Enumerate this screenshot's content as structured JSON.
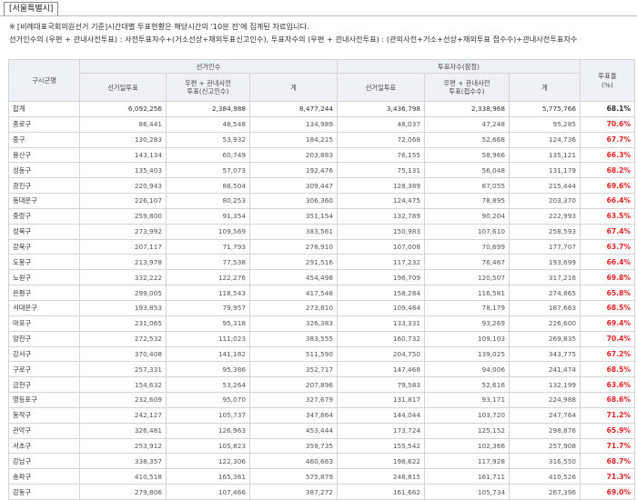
{
  "header": {
    "region_tab": "[서울특별시]"
  },
  "notes": {
    "marker": "※",
    "line1": "[비례대표국회의원선거 기준]시간대별 투표현황은 해당시간의 '10분 전'에 집계된 자료입니다.",
    "line2": "선거인수의 (우편 + 관내사전투표) : 사전투표자수+(거소선상+재외투표신고인수), 투표자수의 (우편 + 관내사전투표) : (관외사전+거소+선상+재외투표 접수수)+관내사전투표자수"
  },
  "table": {
    "headers": {
      "district": "구시군명",
      "electors_group": "선거인수",
      "voters_group": "투표자수(잠정)",
      "rate_line1": "투표율",
      "rate_line2": "(%)",
      "election_day": "선거일투표",
      "electors_mail_line1": "우편 + 관내사전",
      "electors_mail_line2": "투표(신고인수)",
      "total": "계",
      "voters_election_day": "선거일투표",
      "voters_mail_line1": "우편 + 관내사전",
      "voters_mail_line2": "투표(접수수)",
      "voters_total": "계"
    },
    "rows": [
      {
        "name": "합계",
        "e_day": "6,092,256",
        "e_mail": "2,384,988",
        "e_total": "8,477,244",
        "v_day": "3,436,798",
        "v_mail": "2,338,968",
        "v_total": "5,775,766",
        "rate": "68.1%"
      },
      {
        "name": "종로구",
        "e_day": "86,441",
        "e_mail": "48,548",
        "e_total": "134,989",
        "v_day": "48,037",
        "v_mail": "47,248",
        "v_total": "95,285",
        "rate": "70.6%"
      },
      {
        "name": "중구",
        "e_day": "130,283",
        "e_mail": "53,932",
        "e_total": "184,215",
        "v_day": "72,068",
        "v_mail": "52,668",
        "v_total": "124,736",
        "rate": "67.7%"
      },
      {
        "name": "용산구",
        "e_day": "143,134",
        "e_mail": "60,749",
        "e_total": "203,883",
        "v_day": "76,155",
        "v_mail": "58,966",
        "v_total": "135,121",
        "rate": "66.3%"
      },
      {
        "name": "성동구",
        "e_day": "135,403",
        "e_mail": "57,073",
        "e_total": "192,476",
        "v_day": "75,131",
        "v_mail": "56,048",
        "v_total": "131,179",
        "rate": "68.2%"
      },
      {
        "name": "광진구",
        "e_day": "220,943",
        "e_mail": "88,504",
        "e_total": "309,447",
        "v_day": "128,389",
        "v_mail": "87,055",
        "v_total": "215,444",
        "rate": "69.6%"
      },
      {
        "name": "동대문구",
        "e_day": "226,107",
        "e_mail": "80,253",
        "e_total": "306,360",
        "v_day": "124,475",
        "v_mail": "78,895",
        "v_total": "203,370",
        "rate": "66.4%"
      },
      {
        "name": "중랑구",
        "e_day": "259,800",
        "e_mail": "91,354",
        "e_total": "351,154",
        "v_day": "132,789",
        "v_mail": "90,204",
        "v_total": "222,993",
        "rate": "63.5%"
      },
      {
        "name": "성북구",
        "e_day": "273,992",
        "e_mail": "109,569",
        "e_total": "383,561",
        "v_day": "150,983",
        "v_mail": "107,610",
        "v_total": "258,593",
        "rate": "67.4%"
      },
      {
        "name": "강북구",
        "e_day": "207,117",
        "e_mail": "71,793",
        "e_total": "278,910",
        "v_day": "107,008",
        "v_mail": "70,699",
        "v_total": "177,707",
        "rate": "63.7%"
      },
      {
        "name": "도봉구",
        "e_day": "213,978",
        "e_mail": "77,538",
        "e_total": "291,516",
        "v_day": "117,232",
        "v_mail": "76,467",
        "v_total": "193,699",
        "rate": "66.4%"
      },
      {
        "name": "노원구",
        "e_day": "332,222",
        "e_mail": "122,276",
        "e_total": "454,498",
        "v_day": "196,709",
        "v_mail": "120,507",
        "v_total": "317,216",
        "rate": "69.8%"
      },
      {
        "name": "은평구",
        "e_day": "299,005",
        "e_mail": "118,543",
        "e_total": "417,548",
        "v_day": "158,284",
        "v_mail": "116,581",
        "v_total": "274,865",
        "rate": "65.8%"
      },
      {
        "name": "서대문구",
        "e_day": "193,853",
        "e_mail": "79,957",
        "e_total": "273,810",
        "v_day": "109,484",
        "v_mail": "78,179",
        "v_total": "187,663",
        "rate": "68.5%"
      },
      {
        "name": "마포구",
        "e_day": "231,065",
        "e_mail": "95,318",
        "e_total": "326,383",
        "v_day": "133,331",
        "v_mail": "93,269",
        "v_total": "226,600",
        "rate": "69.4%"
      },
      {
        "name": "양천구",
        "e_day": "272,532",
        "e_mail": "111,023",
        "e_total": "383,555",
        "v_day": "160,732",
        "v_mail": "109,103",
        "v_total": "269,835",
        "rate": "70.4%"
      },
      {
        "name": "강서구",
        "e_day": "370,408",
        "e_mail": "141,182",
        "e_total": "511,590",
        "v_day": "204,750",
        "v_mail": "139,025",
        "v_total": "343,775",
        "rate": "67.2%"
      },
      {
        "name": "구로구",
        "e_day": "257,331",
        "e_mail": "95,386",
        "e_total": "352,717",
        "v_day": "147,468",
        "v_mail": "94,006",
        "v_total": "241,474",
        "rate": "68.5%"
      },
      {
        "name": "금천구",
        "e_day": "154,632",
        "e_mail": "53,264",
        "e_total": "207,896",
        "v_day": "79,583",
        "v_mail": "52,616",
        "v_total": "132,199",
        "rate": "63.6%"
      },
      {
        "name": "영등포구",
        "e_day": "232,609",
        "e_mail": "95,070",
        "e_total": "327,679",
        "v_day": "131,817",
        "v_mail": "93,171",
        "v_total": "224,988",
        "rate": "68.6%"
      },
      {
        "name": "동작구",
        "e_day": "242,127",
        "e_mail": "105,737",
        "e_total": "347,864",
        "v_day": "144,044",
        "v_mail": "103,720",
        "v_total": "247,764",
        "rate": "71.2%"
      },
      {
        "name": "관악구",
        "e_day": "326,481",
        "e_mail": "126,963",
        "e_total": "453,444",
        "v_day": "173,724",
        "v_mail": "125,152",
        "v_total": "298,876",
        "rate": "65.9%"
      },
      {
        "name": "서초구",
        "e_day": "253,912",
        "e_mail": "105,823",
        "e_total": "359,735",
        "v_day": "155,542",
        "v_mail": "102,366",
        "v_total": "257,908",
        "rate": "71.7%"
      },
      {
        "name": "강남구",
        "e_day": "338,357",
        "e_mail": "122,306",
        "e_total": "460,663",
        "v_day": "198,622",
        "v_mail": "117,928",
        "v_total": "316,550",
        "rate": "68.7%"
      },
      {
        "name": "송파구",
        "e_day": "410,518",
        "e_mail": "165,361",
        "e_total": "575,879",
        "v_day": "248,815",
        "v_mail": "161,711",
        "v_total": "410,526",
        "rate": "71.3%"
      },
      {
        "name": "강동구",
        "e_day": "279,806",
        "e_mail": "107,466",
        "e_total": "387,272",
        "v_day": "161,662",
        "v_mail": "105,734",
        "v_total": "267,396",
        "rate": "69.0%"
      }
    ]
  }
}
